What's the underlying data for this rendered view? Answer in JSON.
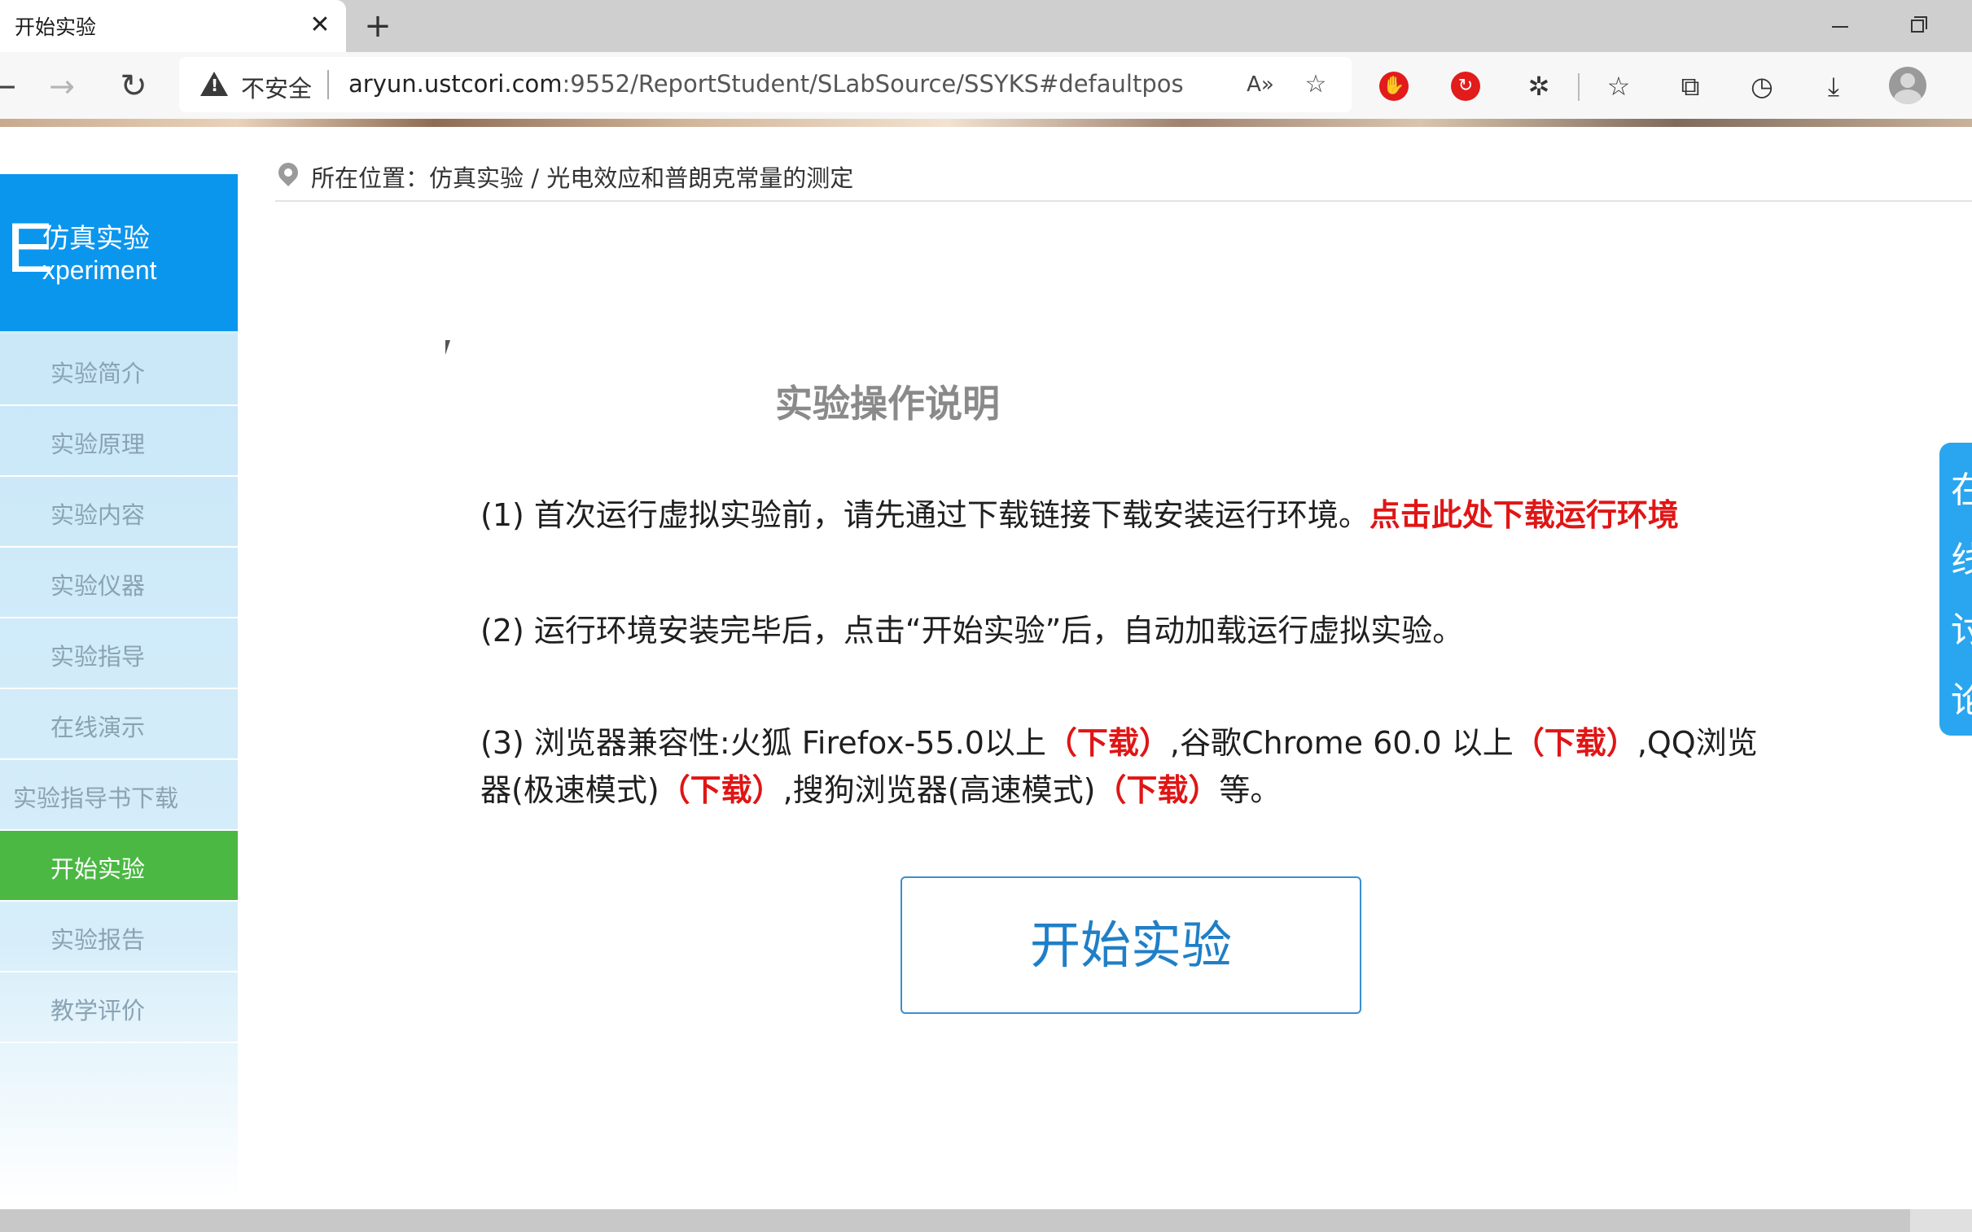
{
  "browser": {
    "tab_title": "开始实验",
    "tab_close": "✕",
    "new_tab": "+",
    "security_label": "不安全",
    "url_host": "aryun.ustcori.com",
    "url_rest": ":9552/ReportStudent/SLabSource/SSYKS#defaultpos",
    "read_aloud_icon": "A))"
  },
  "sidebar": {
    "header_letter": "E",
    "header_cn": "仿真实验",
    "header_en": "xperiment",
    "items": [
      {
        "label": "实验简介"
      },
      {
        "label": "实验原理"
      },
      {
        "label": "实验内容"
      },
      {
        "label": "实验仪器"
      },
      {
        "label": "实验指导"
      },
      {
        "label": "在线演示"
      },
      {
        "label": "实验指导书下载"
      },
      {
        "label": "开始实验"
      },
      {
        "label": "实验报告"
      },
      {
        "label": "教学评价"
      }
    ],
    "active_index": 7
  },
  "breadcrumb": {
    "text": "所在位置：仿真实验 / 光电效应和普朗克常量的测定"
  },
  "main": {
    "title": "实验操作说明",
    "p1_text": "(1) 首次运行虚拟实验前，请先通过下载链接下载安装运行环境。",
    "p1_link": "点击此处下载运行环境",
    "p2_text": "(2) 运行环境安装完毕后，点击“开始实验”后，自动加载运行虚拟实验。",
    "p3_a": "(3) 浏览器兼容性:火狐 Firefox-55.0以上",
    "p3_dl": "（下载）",
    "p3_b": ",谷歌Chrome 60.0 以上",
    "p3_c": ",QQ浏览器(极速模式)",
    "p3_d": ",搜狗浏览器(高速模式)",
    "p3_e": "等。",
    "start_button": "开始实验"
  },
  "float_tab": {
    "text": "在线讨论"
  },
  "colors": {
    "sidebar_header": "#0b96ee",
    "active_item": "#4bb843",
    "link_red": "#e01515",
    "button_text": "#1f7fc7"
  }
}
